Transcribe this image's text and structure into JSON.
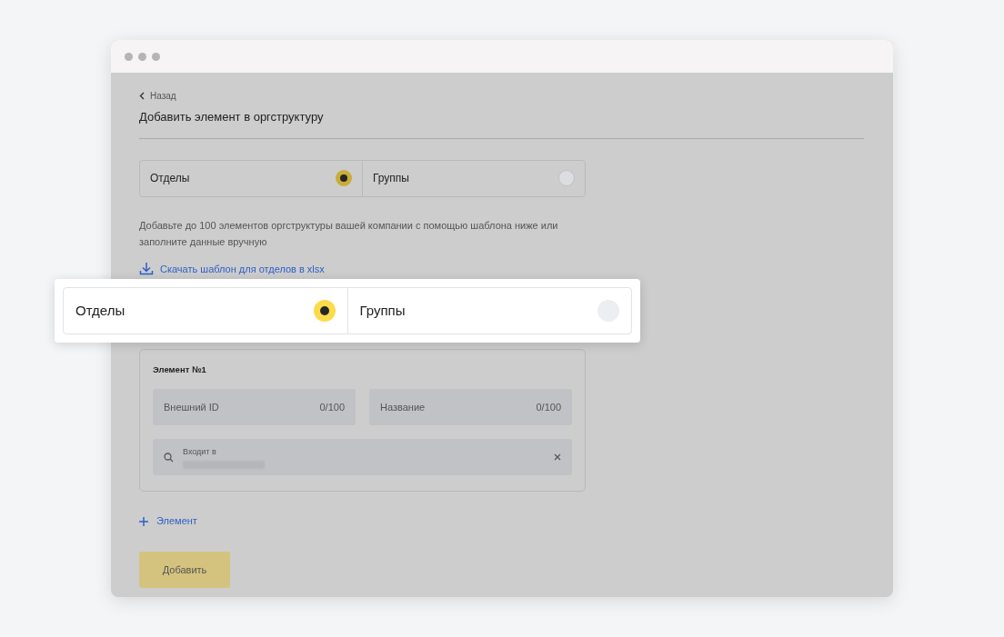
{
  "back_link": "Назад",
  "title": "Добавить элемент в оргструктуру",
  "type_switch": [
    {
      "label": "Отделы",
      "selected": true
    },
    {
      "label": "Группы",
      "selected": false
    }
  ],
  "description": "Добавьте до 100 элементов оргструктуры вашей компании с помощью шаблона ниже или заполните данные вручную",
  "download_link": "Скачать шаблон для отделов в xlsx",
  "element_card": {
    "title": "Элемент №1",
    "fields": [
      {
        "placeholder": "Внешний ID",
        "counter": "0/100"
      },
      {
        "placeholder": "Название",
        "counter": "0/100"
      }
    ],
    "search": {
      "label": "Входит в"
    }
  },
  "add_element": "Элемент",
  "submit_button": "Добавить",
  "callout": {
    "segments": [
      {
        "label": "Отделы",
        "selected": true
      },
      {
        "label": "Группы",
        "selected": false
      }
    ]
  }
}
